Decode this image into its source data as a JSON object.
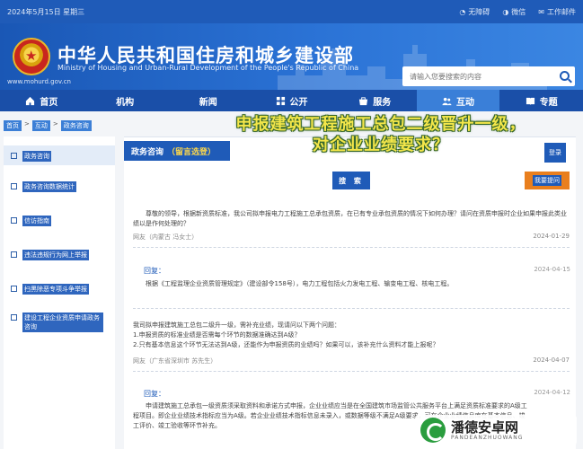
{
  "topbar": {
    "date": "2024年5月15日 星期三",
    "accessibility": "无障碍",
    "wechat": "微信",
    "work_portal": "工作邮件"
  },
  "header": {
    "title_cn": "中华人民共和国住房和城乡建设部",
    "title_en": "Ministry of Housing and Urban-Rural Development of the People's Republic of China",
    "url": "www.mohurd.gov.cn",
    "search_placeholder": "请输入您要搜索的内容"
  },
  "nav": [
    {
      "label": "首页",
      "icon": "home-icon"
    },
    {
      "label": "机构",
      "icon": ""
    },
    {
      "label": "新闻",
      "icon": ""
    },
    {
      "label": "公开",
      "icon": "grid-icon"
    },
    {
      "label": "服务",
      "icon": "service-icon"
    },
    {
      "label": "互动",
      "icon": "users-icon",
      "active": true
    },
    {
      "label": "专题",
      "icon": "book-icon"
    }
  ],
  "breadcrumb": [
    "首页",
    "互动",
    "政务咨询"
  ],
  "sidebar": [
    {
      "label": "政务咨询",
      "active": true
    },
    {
      "label": "政务咨询数据统计"
    },
    {
      "label": "信访指南"
    },
    {
      "label": "违法违规行为网上举报"
    },
    {
      "label": "扫黑除恶专项斗争举报"
    },
    {
      "label": "建设工程企业资质申请政务咨询"
    }
  ],
  "main": {
    "section_title": "政务咨询",
    "section_sub": "（留言选登）",
    "overlay_title_line1": "申报建筑工程施工总包二级晋升一级，",
    "overlay_title_line2": "对企业业绩要求？",
    "search_label": "搜 索",
    "login_label": "登录",
    "ask_label": "我要提问"
  },
  "posts": [
    {
      "question": "　　尊敬的领导，根据新资质标准，我公司拟申报电力工程施工总承包资质，在已有专业承包资质的情况下如何办理？请问在资质申报时企业如果申报此类业绩以是作何处理的？",
      "user": "网友（内蒙古 冯女士）",
      "date": "2024-01-29",
      "reply_label": "回复：",
      "reply_date": "2024-04-15",
      "reply": "　　根据《工程监理企业资质管理规定》（建设部令158号），电力工程包括火力发电工程、输变电工程、核电工程。"
    },
    {
      "question": "我司拟申报建筑施工总包二级升一级，需补充业绩，现请问以下两个问题：\n1.申报资质的标准业绩是否需每个环节的数据准确达到A级？\n2.只有基本信息这个环节无法达到A级，还能作为申报资质的业绩吗？如果可以，该补充什么资料才能上报呢？",
      "user": "网友（广东省深圳市 苏先生）",
      "date": "2024-04-07",
      "reply_label": "回复：",
      "reply_date": "2024-04-12",
      "reply": "　　申请建筑施工总承包一级资质须采取资料和承诺方式申报，企业业绩应当是在全国建筑市场监管公共服务平台上满足资质标准要求的A级工程项目。即企业业绩技术指标应当为A级。若企业业绩技术指标信息未录入，或数据等级不满足A级要求，可在企业业绩信息库在基本信息、竣工评价、竣工验收等环节补充。"
    }
  ],
  "watermark": {
    "title": "潘德安卓网",
    "sub": "PANDEANZHUOWANG"
  },
  "colors": {
    "primary": "#1f5bb8",
    "accent": "#e97f1e",
    "overlay_text": "#f3e64a"
  }
}
